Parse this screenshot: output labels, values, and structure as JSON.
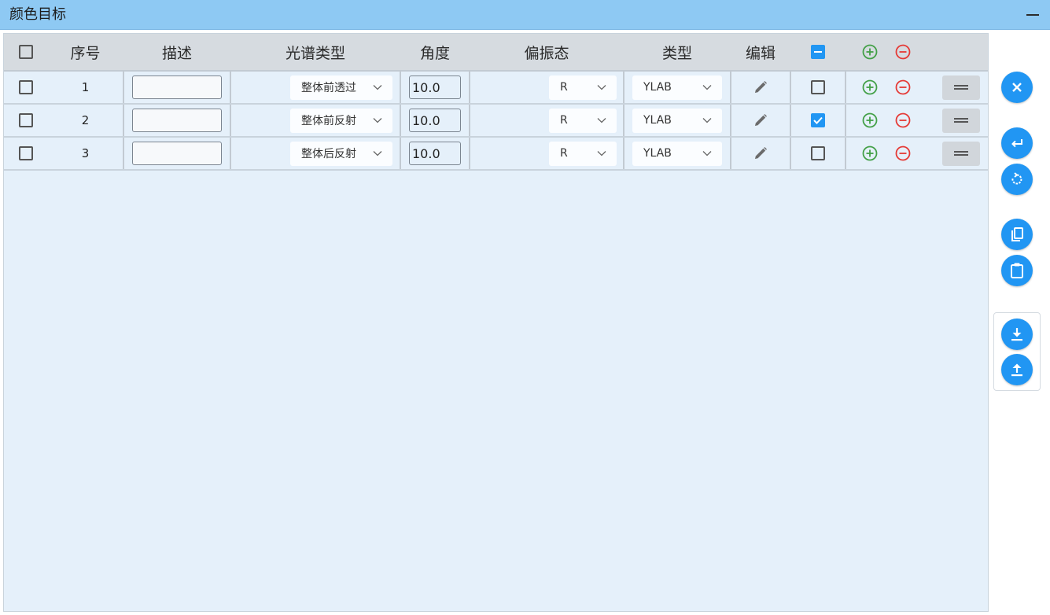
{
  "window": {
    "title": "颜色目标"
  },
  "table": {
    "headers": {
      "index": "序号",
      "desc": "描述",
      "spectrum": "光谱类型",
      "angle": "角度",
      "polarization": "偏振态",
      "type": "类型",
      "edit": "编辑"
    },
    "rows": [
      {
        "index": "1",
        "desc": "",
        "spectrum": "整体前透过",
        "angle": "10.0",
        "polarization": "R",
        "type": "YLAB",
        "selected": false,
        "enabled": false
      },
      {
        "index": "2",
        "desc": "",
        "spectrum": "整体前反射",
        "angle": "10.0",
        "polarization": "R",
        "type": "YLAB",
        "selected": false,
        "enabled": true
      },
      {
        "index": "3",
        "desc": "",
        "spectrum": "整体后反射",
        "angle": "10.0",
        "polarization": "R",
        "type": "YLAB",
        "selected": false,
        "enabled": false
      }
    ]
  },
  "colors": {
    "accent": "#2196f3",
    "add": "#43a047",
    "remove": "#e53935",
    "titlebar": "#8ec9f3",
    "grid_bg": "#e5f0fa"
  },
  "icons": {
    "side": [
      "close-icon",
      "return-icon",
      "reset-icon",
      "copy-icon",
      "paste-icon",
      "download-icon",
      "upload-icon"
    ],
    "row": [
      "pencil-icon",
      "add-circle-icon",
      "remove-circle-icon",
      "drag-handle-icon"
    ]
  }
}
